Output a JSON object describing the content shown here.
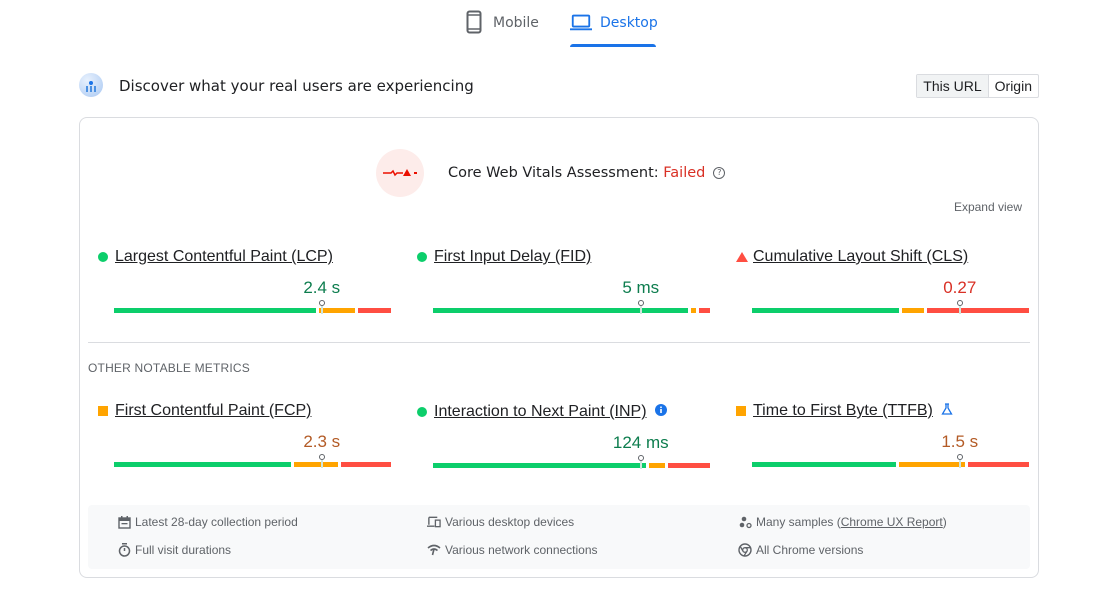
{
  "tabs": [
    {
      "label": "Mobile",
      "icon": "smartphone-icon",
      "active": false
    },
    {
      "label": "Desktop",
      "icon": "laptop-icon",
      "active": true
    }
  ],
  "header": {
    "title": "Discover what your real users are experiencing",
    "toggle": [
      {
        "label": "This URL",
        "active": true
      },
      {
        "label": "Origin",
        "active": false
      }
    ]
  },
  "assessment": {
    "label": "Core Web Vitals Assessment:",
    "status": "Failed",
    "help_glyph": "?",
    "expand_label": "Expand view"
  },
  "core_metrics": [
    {
      "name": "Largest Contentful Paint (LCP)",
      "value": "2.4 s",
      "rating": "good",
      "distribution": {
        "good": 0.74,
        "needs_improvement": 0.14,
        "poor": 0.1
      },
      "marker": 0.75
    },
    {
      "name": "First Input Delay (FID)",
      "value": "5 ms",
      "rating": "good",
      "distribution": {
        "good": 0.93,
        "needs_improvement": 0.03,
        "poor": 0.03
      },
      "marker": 0.75
    },
    {
      "name": "Cumulative Layout Shift (CLS)",
      "value": "0.27",
      "rating": "poor",
      "distribution": {
        "good": 0.54,
        "needs_improvement": 0.09,
        "poor": 0.35
      },
      "marker": 0.75
    }
  ],
  "other_title": "OTHER NOTABLE METRICS",
  "other_metrics": [
    {
      "name": "First Contentful Paint (FCP)",
      "value": "2.3 s",
      "rating": "avg",
      "distribution": {
        "good": 0.65,
        "needs_improvement": 0.17,
        "poor": 0.16
      },
      "marker": 0.75
    },
    {
      "name": "Interaction to Next Paint (INP)",
      "value": "124 ms",
      "rating": "good",
      "distribution": {
        "good": 0.78,
        "needs_improvement": 0.07,
        "poor": 0.14
      },
      "marker": 0.75,
      "extra_icon": "info-icon"
    },
    {
      "name": "Time to First Byte (TTFB)",
      "value": "1.5 s",
      "rating": "avg",
      "distribution": {
        "good": 0.53,
        "needs_improvement": 0.25,
        "poor": 0.21
      },
      "marker": 0.75,
      "extra_icon": "flask-icon"
    }
  ],
  "footer": {
    "items": [
      {
        "icon": "calendar-icon",
        "text": "Latest 28-day collection period"
      },
      {
        "icon": "stopwatch-icon",
        "text": "Full visit durations"
      },
      {
        "icon": "devices-icon",
        "text": "Various desktop devices"
      },
      {
        "icon": "network-icon",
        "text": "Various network connections"
      },
      {
        "icon": "samples-icon",
        "text_prefix": "Many samples (",
        "link": "Chrome UX Report",
        "text_suffix": ")"
      },
      {
        "icon": "chrome-icon",
        "text": "All Chrome versions"
      }
    ]
  },
  "colors": {
    "accent": "#1a73e8",
    "good": "#0cce6b",
    "needs_improvement": "#ffa400",
    "poor": "#ff4e42",
    "failed_text": "#d93025"
  }
}
